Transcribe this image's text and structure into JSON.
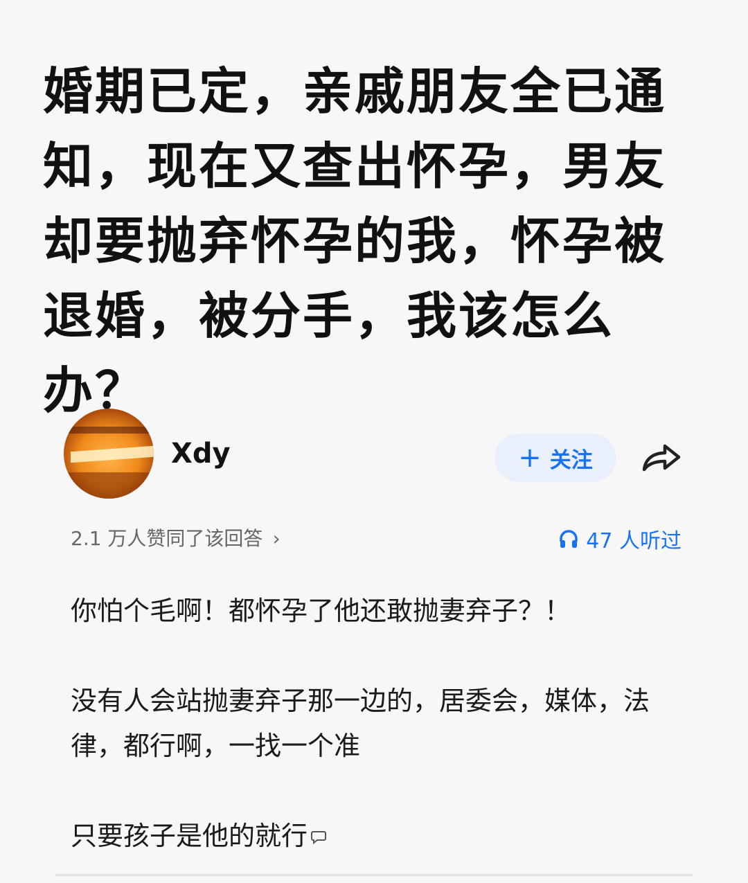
{
  "question": {
    "title": "婚期已定，亲戚朋友全已通知，现在又查出怀孕，男友却要抛弃怀孕的我，怀孕被退婚，被分手，我该怎么办？"
  },
  "author": {
    "name": "Xdy",
    "follow_label": "关注",
    "follow_icon": "plus-icon",
    "share_icon": "share-arrow-icon"
  },
  "stats": {
    "upvote_text": "2.1 万人赞同了该回答",
    "listen_text": "47 人听过",
    "listen_icon": "headphones-icon"
  },
  "answer": {
    "paragraphs": [
      "你怕个毛啊！都怀孕了他还敢抛妻弃子？！",
      "没有人会站抛妻弃子那一边的，居委会，媒体，法律，都行啊，一找一个准",
      "只要孩子是他的就行"
    ]
  },
  "colors": {
    "accent": "#1772f6",
    "follow_bg": "#eaf0fb",
    "background": "#f7f7f7",
    "title": "#111111",
    "secondary_text": "#666666"
  }
}
